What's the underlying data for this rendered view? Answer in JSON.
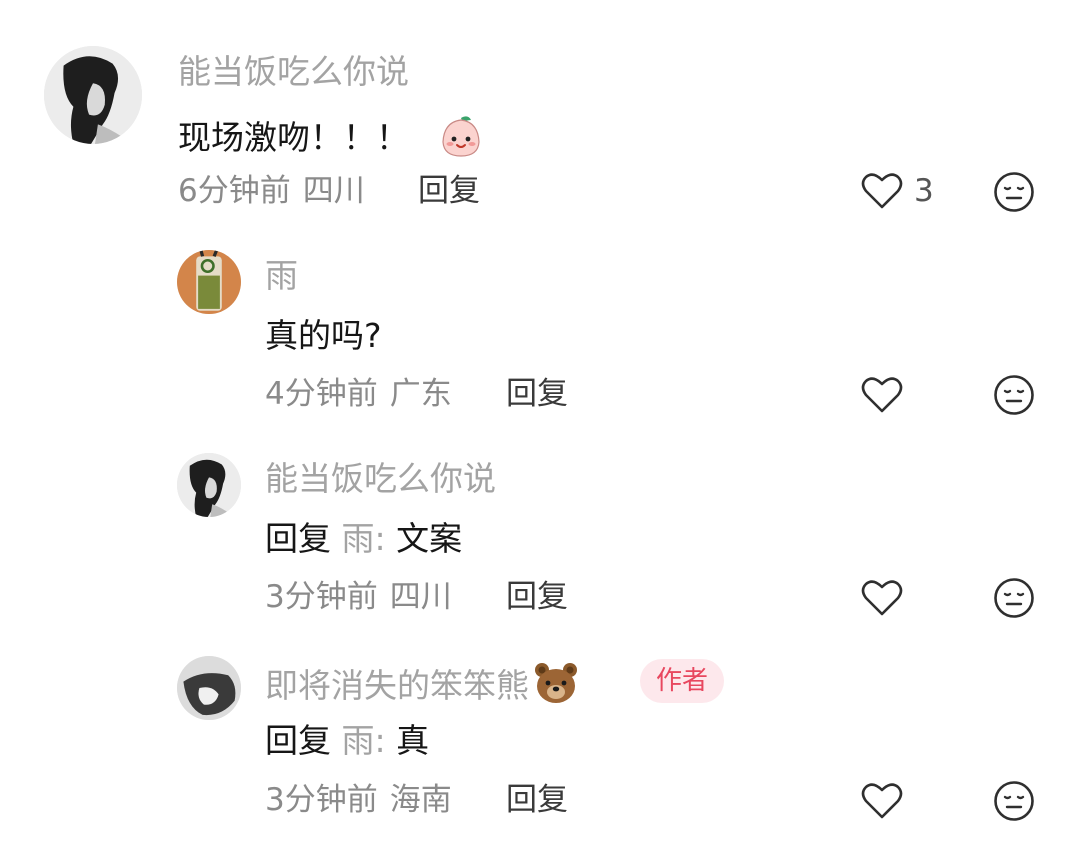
{
  "comments": [
    {
      "username": "能当饭吃么你说",
      "text": "现场激吻！！！",
      "time": "6分钟前",
      "location": "四川",
      "reply_label": "回复",
      "likes": "3"
    },
    {
      "username": "雨",
      "text": "真的吗?",
      "time": "4分钟前",
      "location": "广东",
      "reply_label": "回复"
    },
    {
      "username": "能当饭吃么你说",
      "reply_prefix": "回复",
      "reply_target": "雨:",
      "text": "文案",
      "time": "3分钟前",
      "location": "四川",
      "reply_label": "回复"
    },
    {
      "username": "即将消失的笨笨熊",
      "badge": "作者",
      "reply_prefix": "回复",
      "reply_target": "雨:",
      "text": "真",
      "time": "3分钟前",
      "location": "海南",
      "reply_label": "回复"
    }
  ],
  "icons": {
    "like": "heart-outline-icon",
    "dislike": "neutral-face-icon",
    "bear": "bear-face-emoji",
    "peach": "peach-face-sticker"
  },
  "colors": {
    "badge_bg": "#fde8ec",
    "badge_text": "#e8475f",
    "username": "#a3a3a3"
  }
}
